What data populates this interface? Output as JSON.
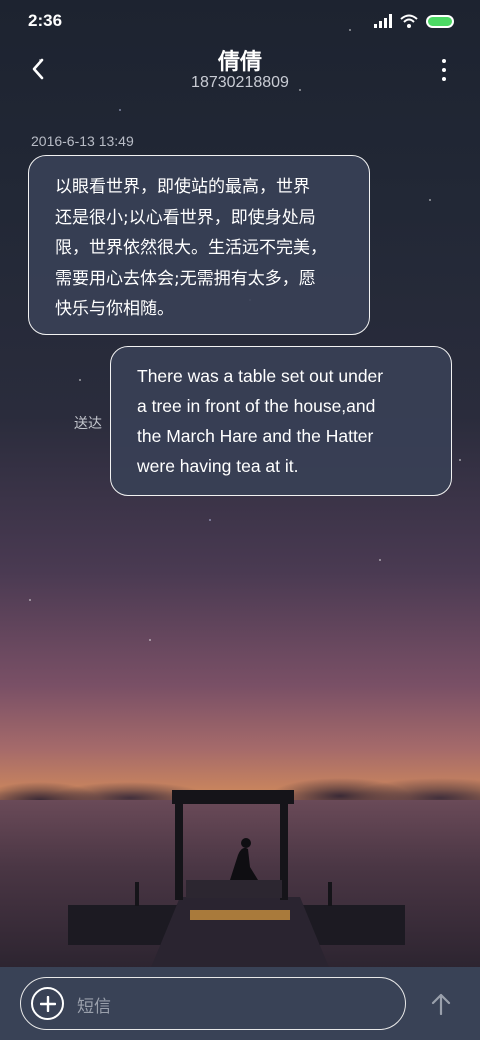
{
  "status_bar": {
    "time": "2:36"
  },
  "header": {
    "title": "倩倩",
    "phone": "18730218809"
  },
  "conversation": {
    "timestamp": "2016-6-13 13:49",
    "incoming": {
      "lines": [
        "以眼看世界，即使站的最高，世界",
        "还是很小;以心看世界，即使身处局",
        "限，世界依然很大。生活远不完美，",
        "需要用心去体会;无需拥有太多，愿",
        "快乐与你相随。"
      ]
    },
    "outgoing": {
      "status": "送达",
      "lines": [
        "There was a table set out under",
        "a tree in front of the house,and",
        "the March Hare and the Hatter",
        "were having tea at it."
      ]
    }
  },
  "composer": {
    "placeholder": "短信"
  },
  "colors": {
    "bubble_bg": "#384056",
    "battery": "#4cd964",
    "composer_bg": "#394256"
  },
  "icons": {
    "back": "chevron-left-icon",
    "more": "more-vertical-icon",
    "add": "plus-circle-icon",
    "send": "arrow-up-icon",
    "signal": "signal-icon",
    "wifi": "wifi-icon",
    "battery": "battery-icon"
  }
}
